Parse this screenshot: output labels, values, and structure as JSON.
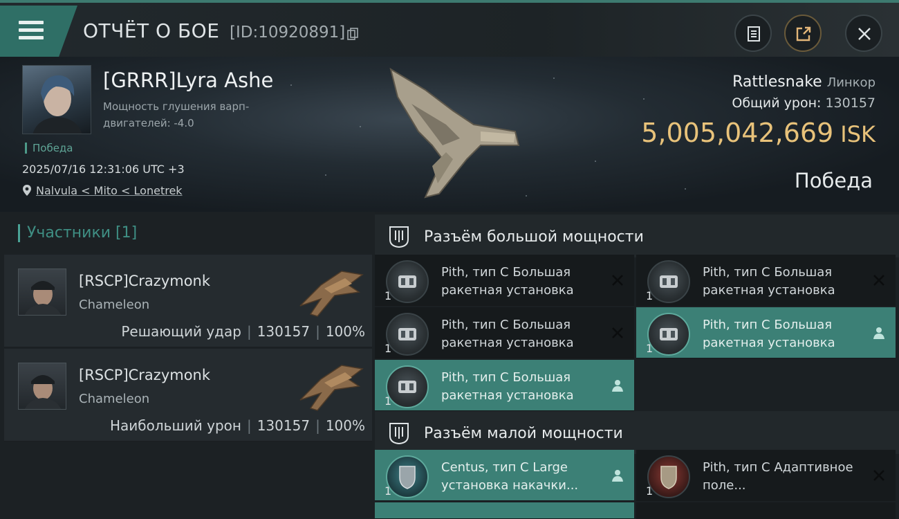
{
  "header": {
    "title": "ОТЧЁТ О БОЕ",
    "report_id": "[ID:10920891]",
    "icons": [
      "menu-icon",
      "copy-icon",
      "clipboard-icon",
      "share-icon",
      "close-icon"
    ]
  },
  "victim": {
    "name": "[GRRR]Lyra Ashe",
    "attribute": "Мощность глушения варп-двигателей: -4.0",
    "tag": "Победа",
    "datetime": "2025/07/16 12:31:06 UTC +3",
    "location": "Nalvula < Mito < Lonetrek",
    "ship": "Rattlesnake",
    "ship_class": "Линкор",
    "total_damage_label": "Общий урон:",
    "total_damage": "130157",
    "isk_value": "5,005,042,669",
    "isk_unit": "ISK",
    "result": "Победа"
  },
  "participants": {
    "title": "Участники [1]",
    "items": [
      {
        "name": "[RSCP]Crazymonk",
        "ship": "Chameleon",
        "role": "Решающий удар",
        "damage": "130157",
        "percent": "100%"
      },
      {
        "name": "[RSCP]Crazymonk",
        "ship": "Chameleon",
        "role": "Наибольший урон",
        "damage": "130157",
        "percent": "100%"
      }
    ]
  },
  "high_slots": {
    "title": "Разъём большой мощности",
    "items": [
      {
        "qty": "1",
        "name": "Pith, тип C Большая ракетная установка",
        "status": "destroyed"
      },
      {
        "qty": "1",
        "name": "Pith, тип C Большая ракетная установка",
        "status": "destroyed"
      },
      {
        "qty": "1",
        "name": "Pith, тип C Большая ракетная установка",
        "status": "destroyed"
      },
      {
        "qty": "1",
        "name": "Pith, тип C Большая ракетная установка",
        "status": "dropped"
      },
      {
        "qty": "1",
        "name": "Pith, тип C Большая ракетная установка",
        "status": "dropped"
      }
    ]
  },
  "low_slots": {
    "title": "Разъём малой мощности",
    "items": [
      {
        "qty": "1",
        "name": "Centus, тип C Large установка накачки...",
        "status": "dropped"
      },
      {
        "qty": "1",
        "name": "Pith, тип C Адаптивное поле...",
        "status": "destroyed"
      }
    ]
  },
  "colors": {
    "accent": "#3c8076",
    "isk": "#e8c27a",
    "victory": "#5fa596"
  }
}
